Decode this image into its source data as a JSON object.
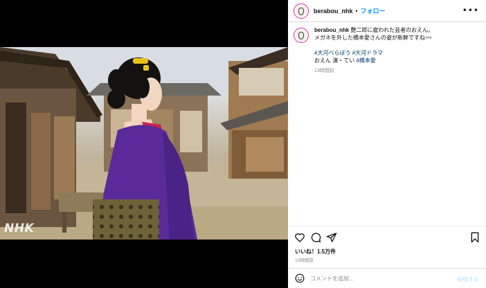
{
  "media": {
    "watermark": "NHK"
  },
  "header": {
    "username": "berabou_nhk",
    "separator": "•",
    "follow_label": "フォロー",
    "more_icon": "more-horizontal-icon"
  },
  "caption": {
    "username": "berabou_nhk",
    "line1": "艶二郎に雇われた芸者のおえん。",
    "line2": "メガネを外した橋本愛さんの姿が新鮮ですね👓",
    "hashtag1": "#大河べらぼう",
    "hashtag2": "#大河ドラマ",
    "cast_text": "おえん 演・てい ",
    "hashtag3": "#橋本愛",
    "time": "13時間前"
  },
  "actions": {
    "like_icon": "heart-icon",
    "comment_icon": "comment-icon",
    "share_icon": "share-icon",
    "save_icon": "bookmark-icon"
  },
  "likes_text": "いいね！1.5万件",
  "post_time": "13時間前",
  "comment": {
    "emoji_icon": "emoji-icon",
    "placeholder": "コメントを追加...",
    "post_label": "投稿する"
  },
  "colors": {
    "accent": "#0095f6",
    "hashtag": "#00376b",
    "kimono": "#5a2a9a"
  }
}
